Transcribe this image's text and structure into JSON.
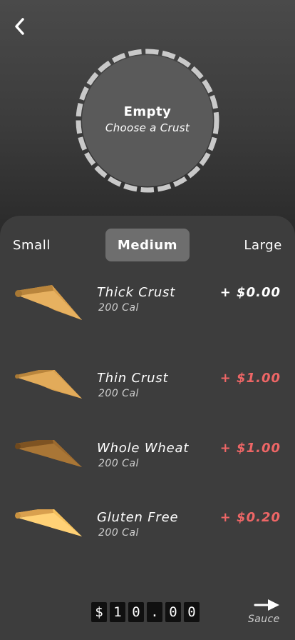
{
  "header": {
    "back_icon": "chevron-left-icon"
  },
  "pizza": {
    "title": "Empty",
    "subtitle": "Choose a Crust"
  },
  "sizes": [
    {
      "label": "Small",
      "selected": false
    },
    {
      "label": "Medium",
      "selected": true
    },
    {
      "label": "Large",
      "selected": false
    }
  ],
  "crusts": [
    {
      "name": "Thick Crust",
      "calories": "200 Cal",
      "price": "+ $0.00",
      "color": "#d9a04e"
    },
    {
      "name": "Thin Crust",
      "calories": "200 Cal",
      "price": "+ $1.00",
      "color": "#d9a04e"
    },
    {
      "name": "Whole Wheat",
      "calories": "200 Cal",
      "price": "+ $1.00",
      "color": "#9c6a2e"
    },
    {
      "name": "Gluten Free",
      "calories": "200 Cal",
      "price": "+ $0.20",
      "color": "#f5c15e"
    }
  ],
  "total": {
    "chars": [
      "$",
      "1",
      "0",
      ".",
      "0",
      "0"
    ]
  },
  "next": {
    "label": "Sauce",
    "icon": "arrow-right-icon"
  },
  "colors": {
    "accent_price": "#ee6666",
    "selected_tab": "#6e6e6e",
    "panel": "#3d3d3d"
  }
}
